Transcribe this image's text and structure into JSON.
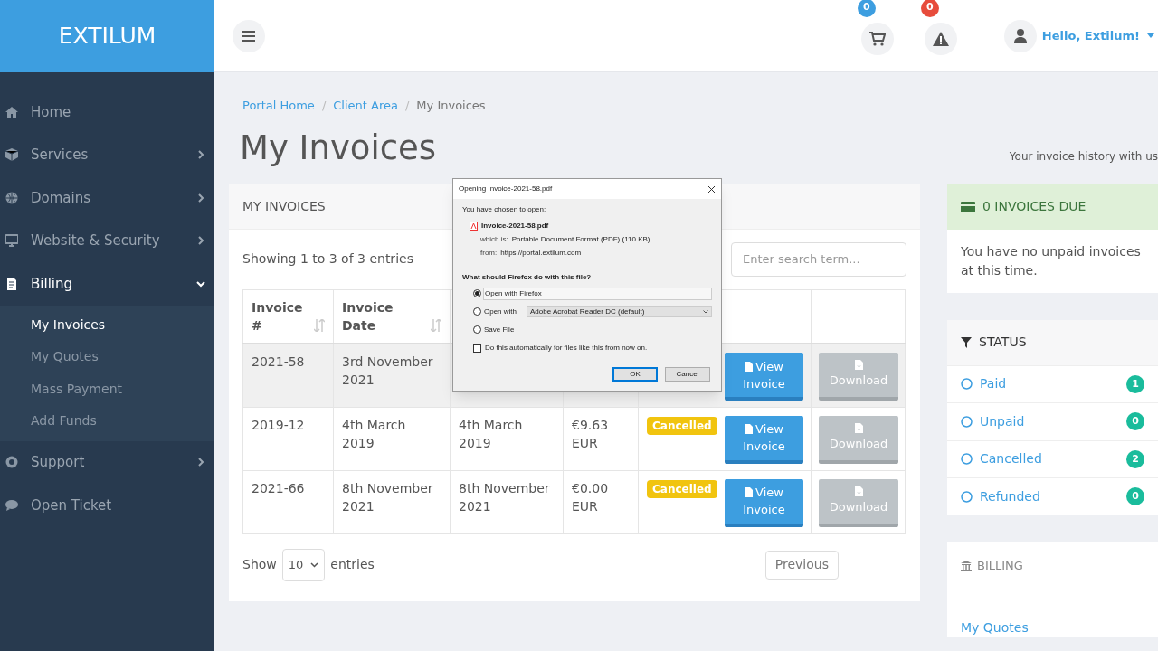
{
  "brand": "EXTILUM",
  "sidebar": {
    "items": [
      {
        "label": "Home",
        "kind": "link"
      },
      {
        "label": "Services",
        "kind": "menu",
        "expanded": false
      },
      {
        "label": "Domains",
        "kind": "menu",
        "expanded": false
      },
      {
        "label": "Website & Security",
        "kind": "menu",
        "expanded": false
      },
      {
        "label": "Billing",
        "kind": "menu",
        "expanded": true,
        "children": [
          {
            "label": "My Invoices",
            "selected": true
          },
          {
            "label": "My Quotes",
            "selected": false
          },
          {
            "label": "Mass Payment",
            "selected": false
          },
          {
            "label": "Add Funds",
            "selected": false
          }
        ]
      },
      {
        "label": "Support",
        "kind": "menu",
        "expanded": false
      },
      {
        "label": "Open Ticket",
        "kind": "link"
      }
    ]
  },
  "topbar": {
    "cart_count": "0",
    "alert_count": "0",
    "user": "Hello, Extilum!"
  },
  "breadcrumb": [
    {
      "label": "Portal Home",
      "current": false
    },
    {
      "separator": "/",
      "label": "Client Area",
      "current": false
    },
    {
      "separator": "/",
      "label": "My Invoices",
      "current": true
    }
  ],
  "page_title": "My Invoices",
  "page_subtitle": "Your invoice history with us",
  "invoices_card": {
    "title": "MY INVOICES",
    "showing": "Showing 1 to 3 of 3 entries",
    "search": {
      "placeholder": "Enter search term..."
    },
    "columns": [
      {
        "label": "Invoice #"
      },
      {
        "label": "Invoice Date"
      }
    ],
    "rows": [
      {
        "invoice": "2021-58",
        "date": "3rd November 2021",
        "view": "View Invoice",
        "download": "Download",
        "hover": true
      },
      {
        "invoice": "2019-12",
        "date": "4th March 2019",
        "due": "4th March 2019",
        "total": "€9.63 EUR",
        "status": "Cancelled",
        "view": "View Invoice",
        "download": "Download",
        "hover": false
      },
      {
        "invoice": "2021-66",
        "date": "8th November 2021",
        "due": "8th November 2021",
        "total": "€0.00 EUR",
        "status": "Cancelled",
        "view": "View Invoice",
        "download": "Download",
        "hover": false
      }
    ],
    "show_label": "Show",
    "page_size": "10",
    "entries_label": "entries",
    "previous": "Previous"
  },
  "due_panel": {
    "title": "0 INVOICES DUE",
    "text": "You have no unpaid invoices at this time."
  },
  "status_panel": {
    "title": "STATUS",
    "items": [
      {
        "label": "Paid",
        "count": "1"
      },
      {
        "label": "Unpaid",
        "count": "0"
      },
      {
        "label": "Cancelled",
        "count": "2"
      },
      {
        "label": "Refunded",
        "count": "0"
      }
    ]
  },
  "billing_panel": {
    "title": "BILLING",
    "links": [
      "My Quotes"
    ]
  },
  "dialog": {
    "title": "Opening Invoice-2021-58.pdf",
    "prompt": "You have chosen to open:",
    "filename": "Invoice-2021-58.pdf",
    "which_label": "which is:",
    "which_value": "Portable Document Format (PDF) (110 KB)",
    "from_label": "from:",
    "from_value": "https://portal.extilum.com",
    "question": "What should Firefox do with this file?",
    "options": [
      {
        "label": "Open with Firefox",
        "selected": true
      },
      {
        "label": "Open with",
        "selected": false,
        "app": "Adobe Acrobat Reader DC (default)"
      },
      {
        "label": "Save File",
        "selected": false
      }
    ],
    "remember": {
      "label": "Do this automatically for files like this from now on.",
      "checked": false
    },
    "buttons": [
      {
        "label": "OK",
        "default": true
      },
      {
        "label": "Cancel",
        "default": false
      }
    ]
  }
}
